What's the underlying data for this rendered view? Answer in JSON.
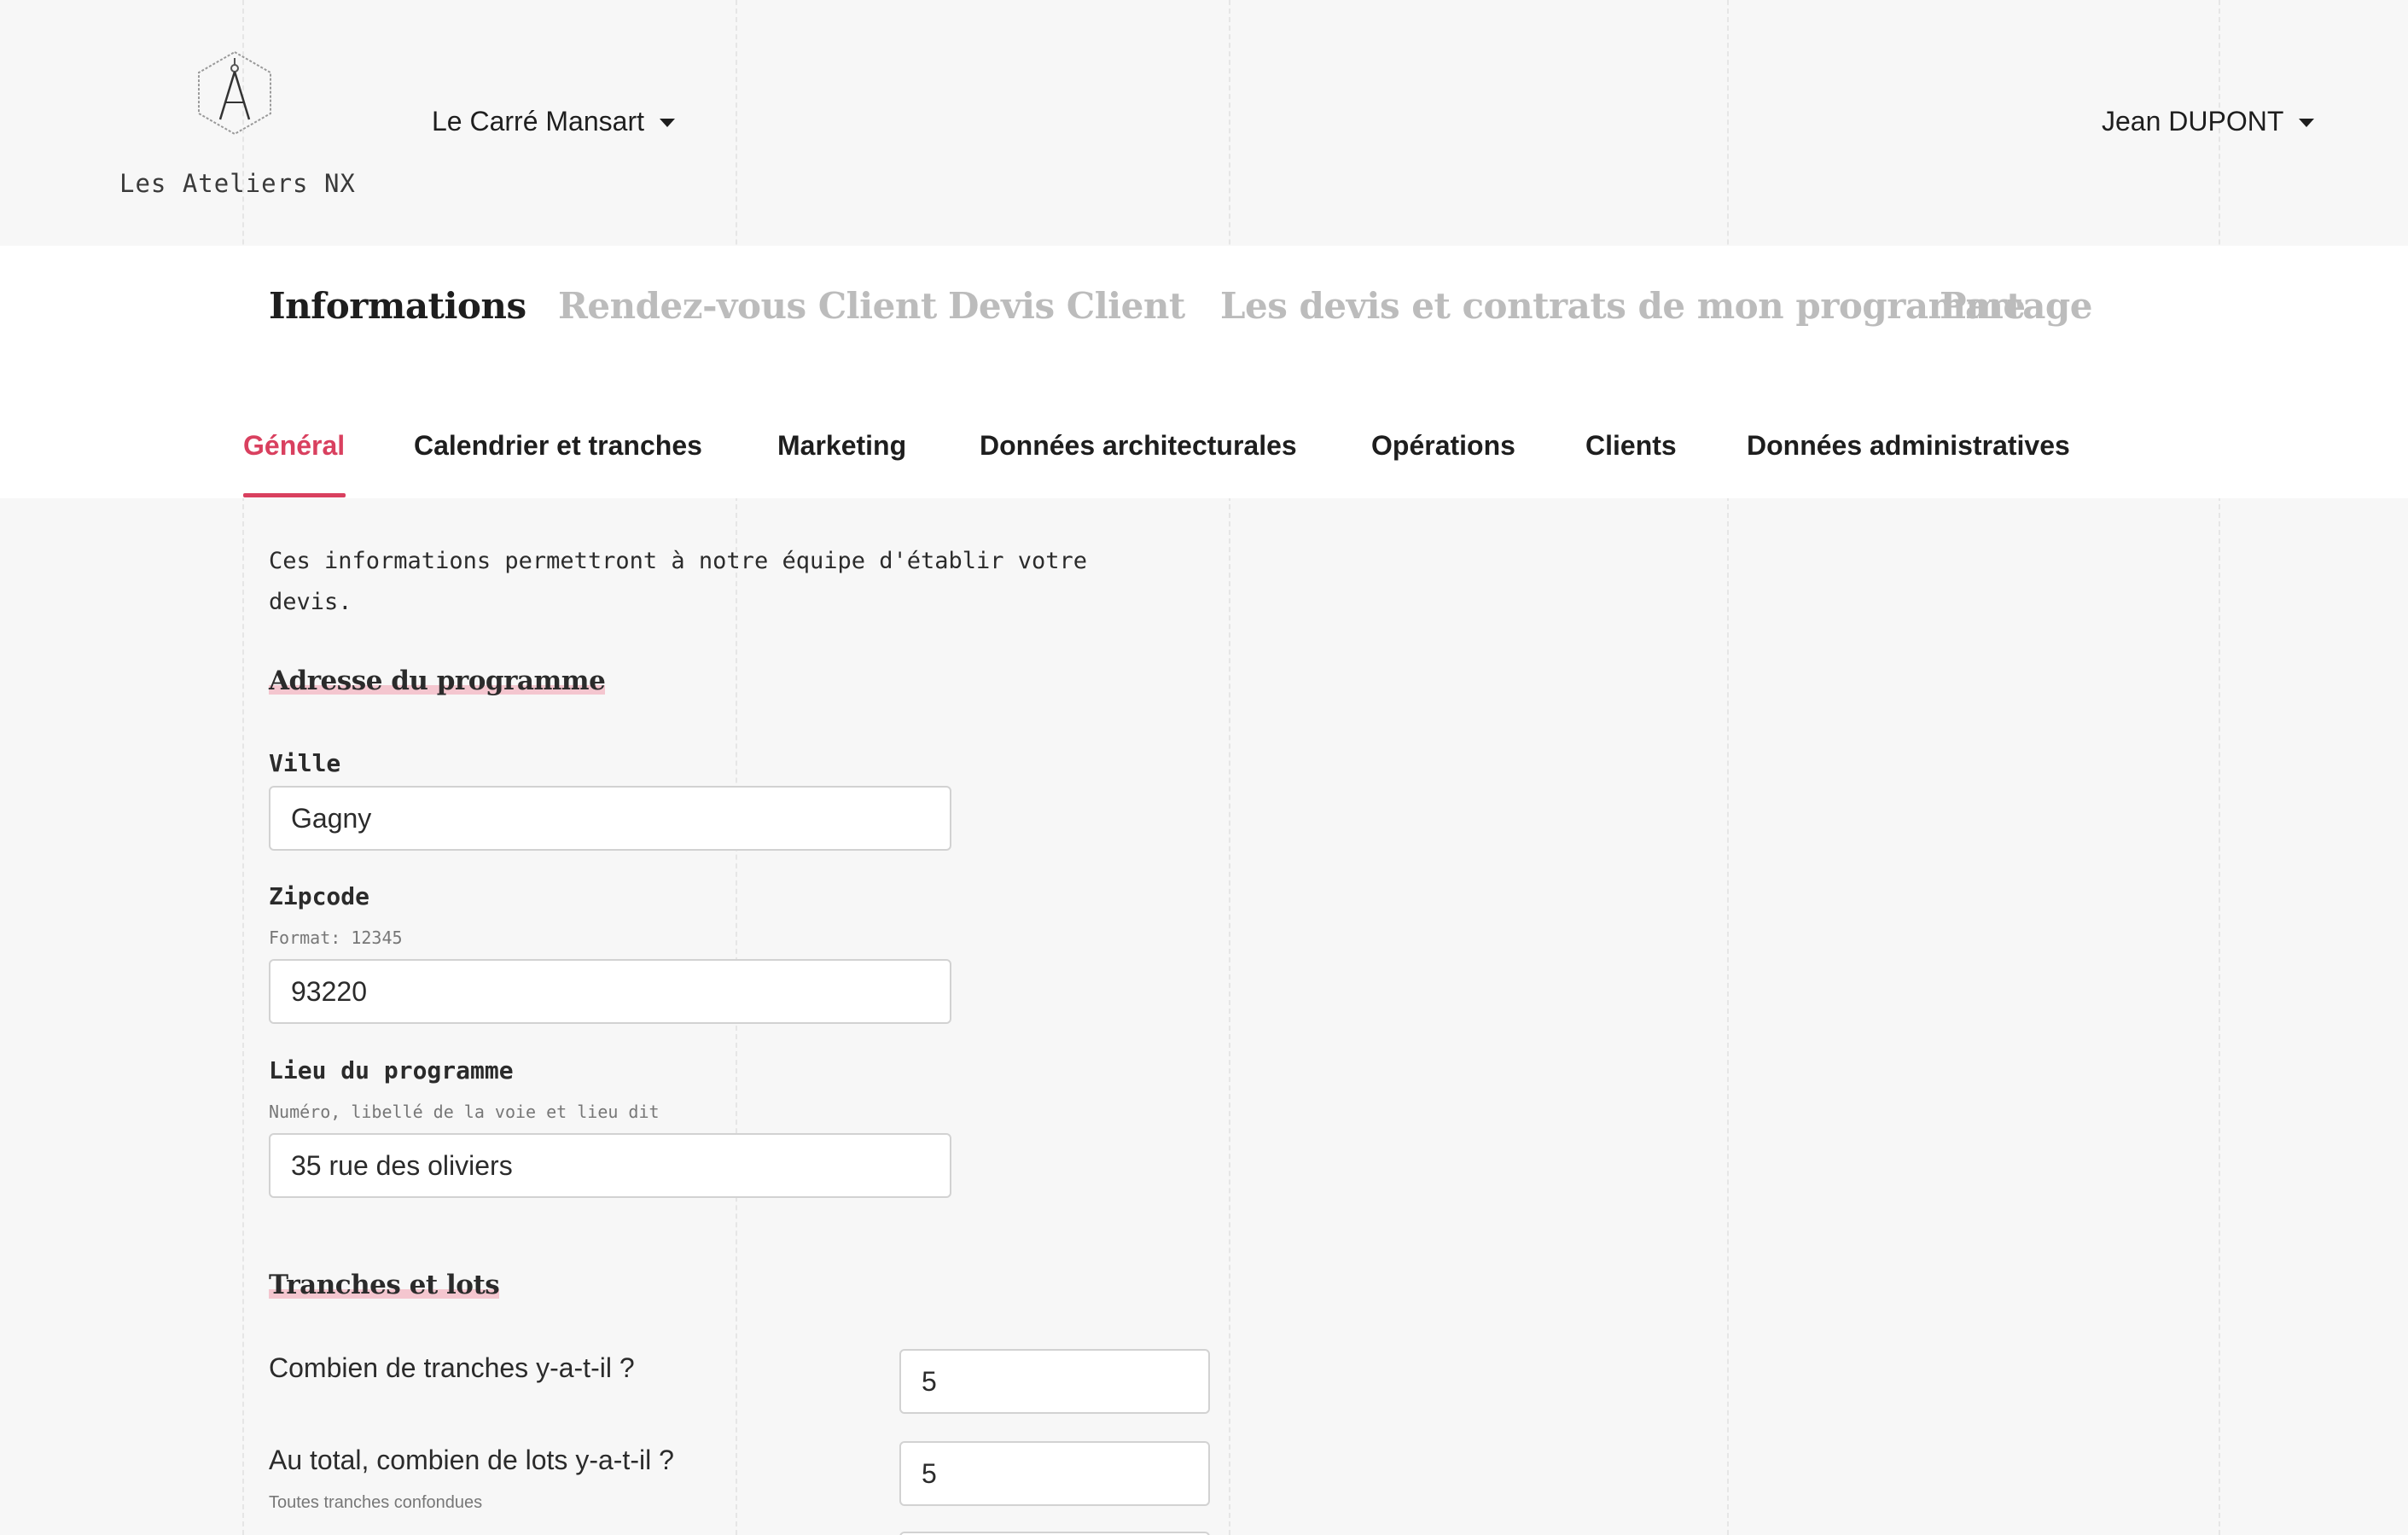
{
  "header": {
    "brand_name": "Les Ateliers NX",
    "program_selector": "Le Carré Mansart",
    "user_menu": "Jean DUPONT"
  },
  "main_tabs": [
    {
      "label": "Informations",
      "active": true
    },
    {
      "label": "Rendez-vous Client",
      "active": false
    },
    {
      "label": "Devis Client",
      "active": false
    },
    {
      "label": "Les devis et contrats de mon programme",
      "active": false
    },
    {
      "label": "Partage",
      "active": false
    }
  ],
  "sub_tabs": [
    {
      "label": "Général",
      "active": true
    },
    {
      "label": "Calendrier et tranches",
      "active": false
    },
    {
      "label": "Marketing",
      "active": false
    },
    {
      "label": "Données architecturales",
      "active": false
    },
    {
      "label": "Opérations",
      "active": false
    },
    {
      "label": "Clients",
      "active": false
    },
    {
      "label": "Données administratives",
      "active": false
    }
  ],
  "intro": "Ces informations permettront à notre équipe d'établir votre devis.",
  "address_section": {
    "title": "Adresse du programme",
    "city": {
      "label": "Ville",
      "value": "Gagny"
    },
    "zipcode": {
      "label": "Zipcode",
      "hint": "Format: 12345",
      "value": "93220"
    },
    "location": {
      "label": "Lieu du programme",
      "hint": "Numéro, libellé de la voie et lieu dit",
      "value": "35 rue des oliviers"
    }
  },
  "lots_section": {
    "title": "Tranches et lots",
    "tranches": {
      "label": "Combien de tranches y-a-t-il ?",
      "value": "5"
    },
    "lots": {
      "label": "Au total, combien de lots y-a-t-il ?",
      "hint": "Toutes tranches confondues",
      "value": "5"
    },
    "next": {
      "value": ""
    }
  },
  "colors": {
    "accent": "#d9405f",
    "highlight": "#f4c6cf",
    "inactive_tab": "#bcbcbc",
    "background": "#f7f7f7"
  }
}
